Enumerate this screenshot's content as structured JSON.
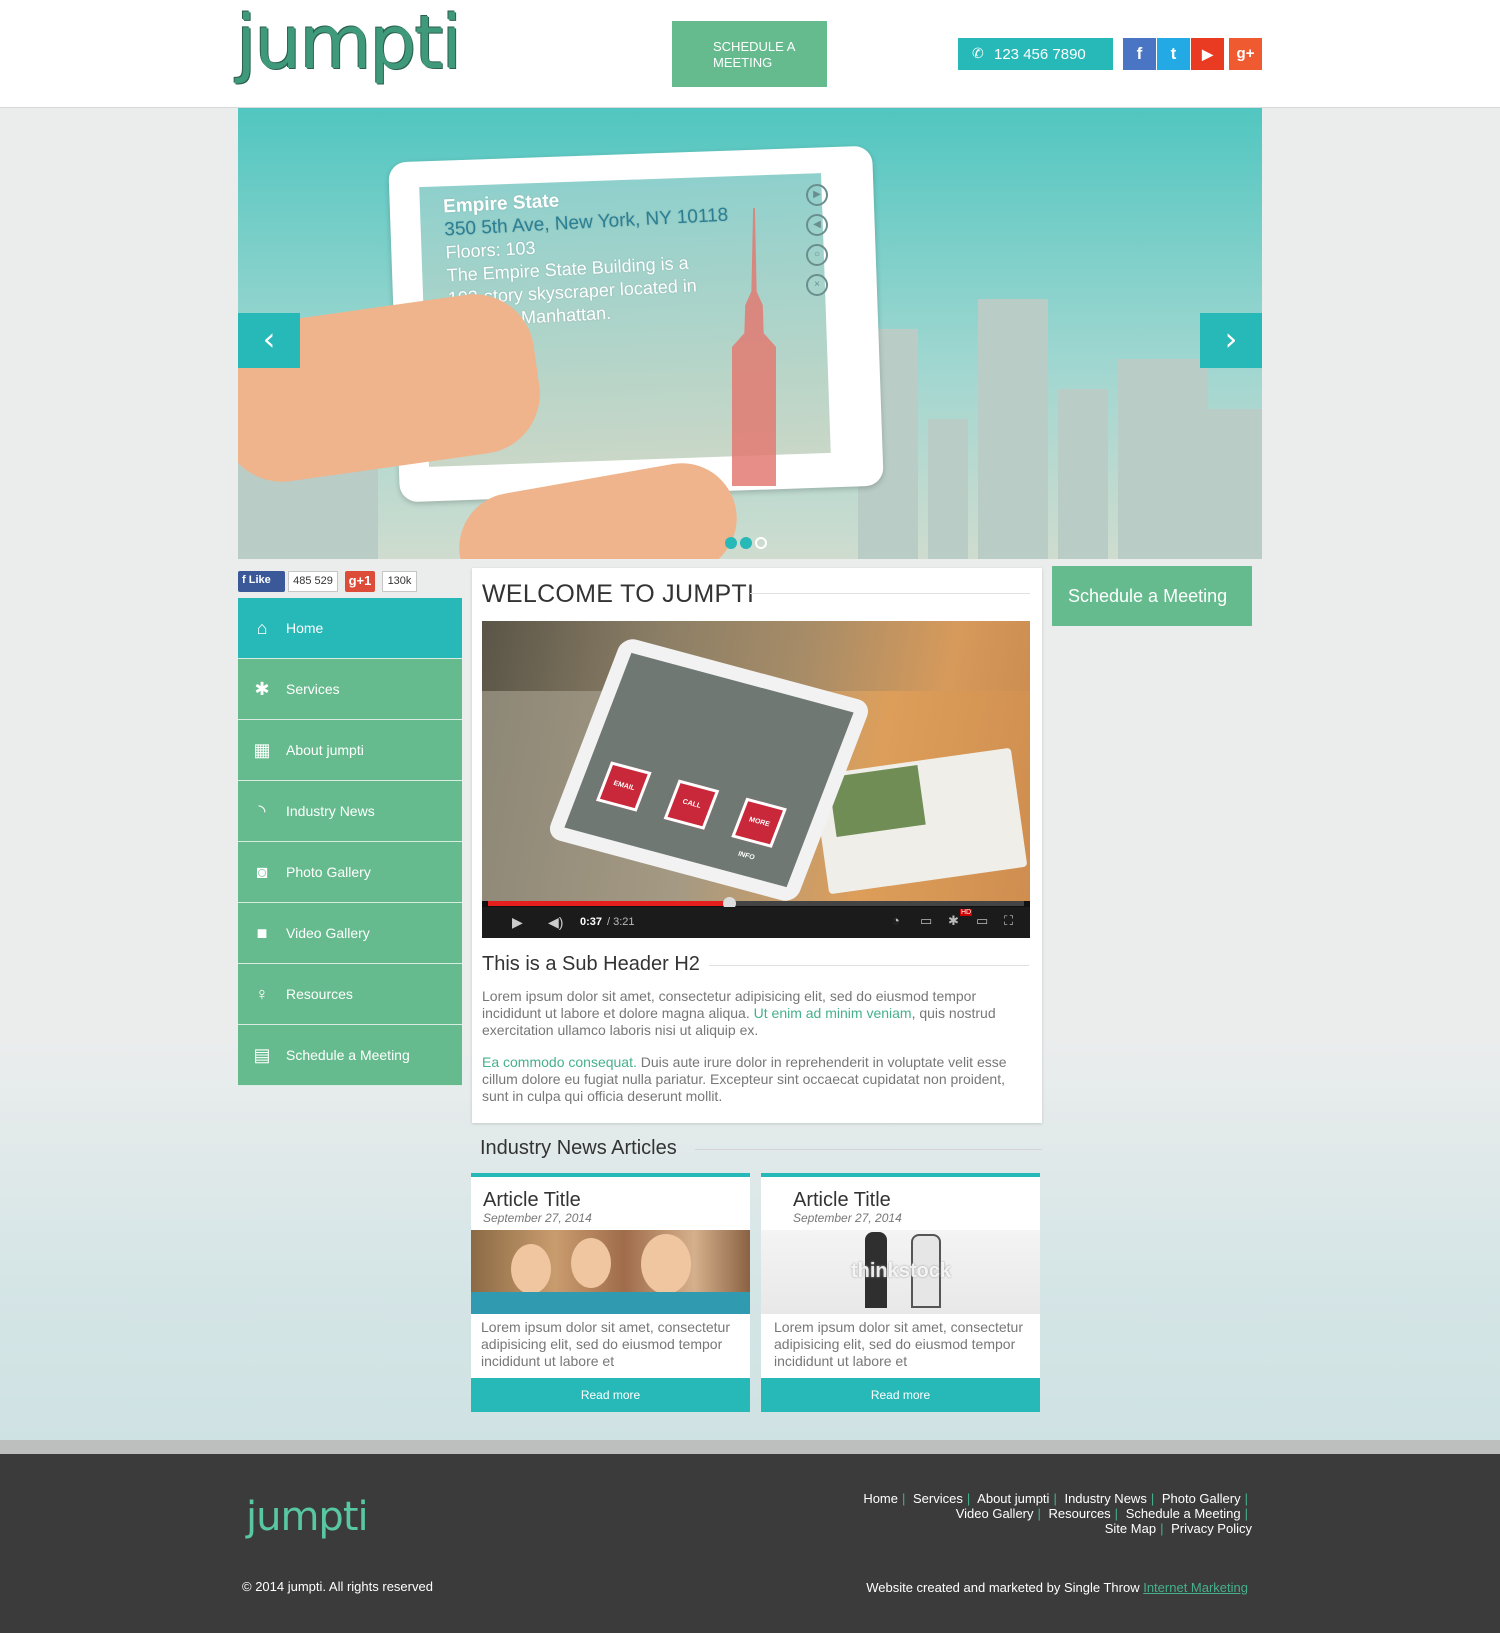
{
  "header": {
    "logo": "jumpti",
    "schedule_button": "SCHEDULE A MEETING",
    "phone": "123 456 7890",
    "social": [
      {
        "name": "facebook",
        "glyph": "f"
      },
      {
        "name": "twitter",
        "glyph": "t"
      },
      {
        "name": "youtube",
        "glyph": "▶"
      },
      {
        "name": "google-plus",
        "glyph": "g+"
      }
    ]
  },
  "hero": {
    "title": "Empire State",
    "address": "350 5th Ave, New York, NY 10118",
    "floors": "Floors: 103",
    "desc1": "The Empire State Building is a",
    "desc2": "103-story skyscraper located in",
    "desc3": "Midtown Manhattan.",
    "prev_arrow": "‹",
    "next_arrow": "›",
    "active_slide": 1,
    "slide_count": 3
  },
  "likebar": {
    "fb_label": "Like",
    "fb_count": "485 529",
    "gp_label": "g+1",
    "gp_count": "130k"
  },
  "nav": [
    {
      "label": "Home",
      "icon": "home-icon",
      "glyph": "⌂"
    },
    {
      "label": "Services",
      "icon": "gear-icon",
      "glyph": "✱"
    },
    {
      "label": "About jumpti",
      "icon": "qr-icon",
      "glyph": "▦"
    },
    {
      "label": "Industry News",
      "icon": "rss-icon",
      "glyph": "◝"
    },
    {
      "label": "Photo Gallery",
      "icon": "camera-icon",
      "glyph": "◙"
    },
    {
      "label": "Video Gallery",
      "icon": "video-camera-icon",
      "glyph": "■"
    },
    {
      "label": "Resources",
      "icon": "lightbulb-icon",
      "glyph": "♀"
    },
    {
      "label": "Schedule a Meeting",
      "icon": "calendar-icon",
      "glyph": "▤"
    }
  ],
  "main": {
    "title": "WELCOME TO JUMPTI",
    "video": {
      "current_time": "0:37",
      "duration": " / 3:21",
      "progress": 0.45,
      "buttons": [
        "EMAIL",
        "CALL",
        "MORE INFO"
      ],
      "hd_badge": "HD"
    },
    "subheader": "This is a Sub Header H2",
    "p1_a": "Lorem ipsum dolor sit amet, consectetur adipisicing elit, sed do eiusmod tempor incididunt ut labore et dolore magna aliqua. ",
    "p1_link": "Ut enim ad minim veniam",
    "p1_b": ", quis nostrud exercitation ullamco laboris nisi ut aliquip ex.",
    "p2_link": "Ea commodo consequat.",
    "p2_b": " Duis aute irure dolor in reprehenderit in voluptate velit esse cillum dolore eu fugiat nulla pariatur. Excepteur sint occaecat cupidatat non proident, sunt in culpa qui officia deserunt mollit."
  },
  "cta": "Schedule a Meeting",
  "news": {
    "heading": "Industry News Articles",
    "articles": [
      {
        "title": "Article Title",
        "date": "September 27, 2014",
        "text": "Lorem ipsum dolor sit amet, consectetur adipisicing elit, sed do eiusmod tempor incididunt ut labore et",
        "read_more": "Read more"
      },
      {
        "title": "Article Title",
        "date": "September 27, 2014",
        "text": "Lorem ipsum dolor sit amet, consectetur adipisicing elit, sed do eiusmod tempor incididunt ut labore et",
        "read_more": "Read more",
        "watermark": "thinkstock"
      }
    ]
  },
  "footer": {
    "logo": "jumpti",
    "links_row1": [
      "Home",
      "Services",
      "About jumpti",
      "Industry News",
      "Photo Gallery"
    ],
    "links_row2": [
      "Video Gallery",
      "Resources",
      "Schedule a Meeting"
    ],
    "links_row3": [
      "Site Map",
      "Privacy Policy"
    ],
    "separator": "|",
    "copyright": "© 2014 jumpti. All rights reserved",
    "credit_text": "Website created and marketed by Single Throw ",
    "credit_link": "Internet Marketing"
  },
  "colors": {
    "teal": "#27b8b8",
    "green": "#65bb8d",
    "link_green": "#46b08b",
    "footer_bg": "#3b3b3b"
  }
}
